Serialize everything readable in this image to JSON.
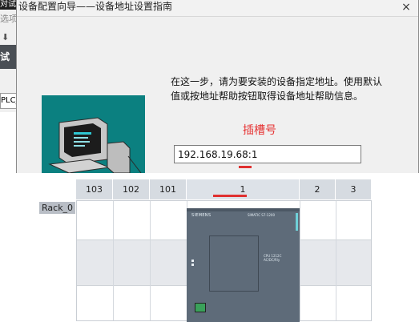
{
  "background_app": {
    "tab_fragment": "对试",
    "menu_fragment": "选项",
    "toolbar_fragment": "试",
    "tree_fragment": "PLC_"
  },
  "dialog": {
    "title": "设备配置向导——设备地址设置指南",
    "close_glyph": "×",
    "description": "在这一步，请为要安装的设备指定地址。使用默认值或按地址帮助按钮取得设备地址帮助信息。",
    "annotation_slot": "插槽号",
    "address_value": "192.168.19.68:1"
  },
  "rack": {
    "label": "Rack_0",
    "slots": [
      "103",
      "102",
      "101",
      "1",
      "2",
      "3"
    ],
    "cpu_brand": "SIEMENS",
    "cpu_model": "SIMATIC S7-1200",
    "cpu_type": "CPU 1212C",
    "cpu_io": "AC/DC/Rly"
  },
  "colors": {
    "picture_bg": "#0b8080",
    "annotation_red": "#e63535",
    "cpu_body": "#5e6b79",
    "rack_header": "#d6dbe1"
  }
}
